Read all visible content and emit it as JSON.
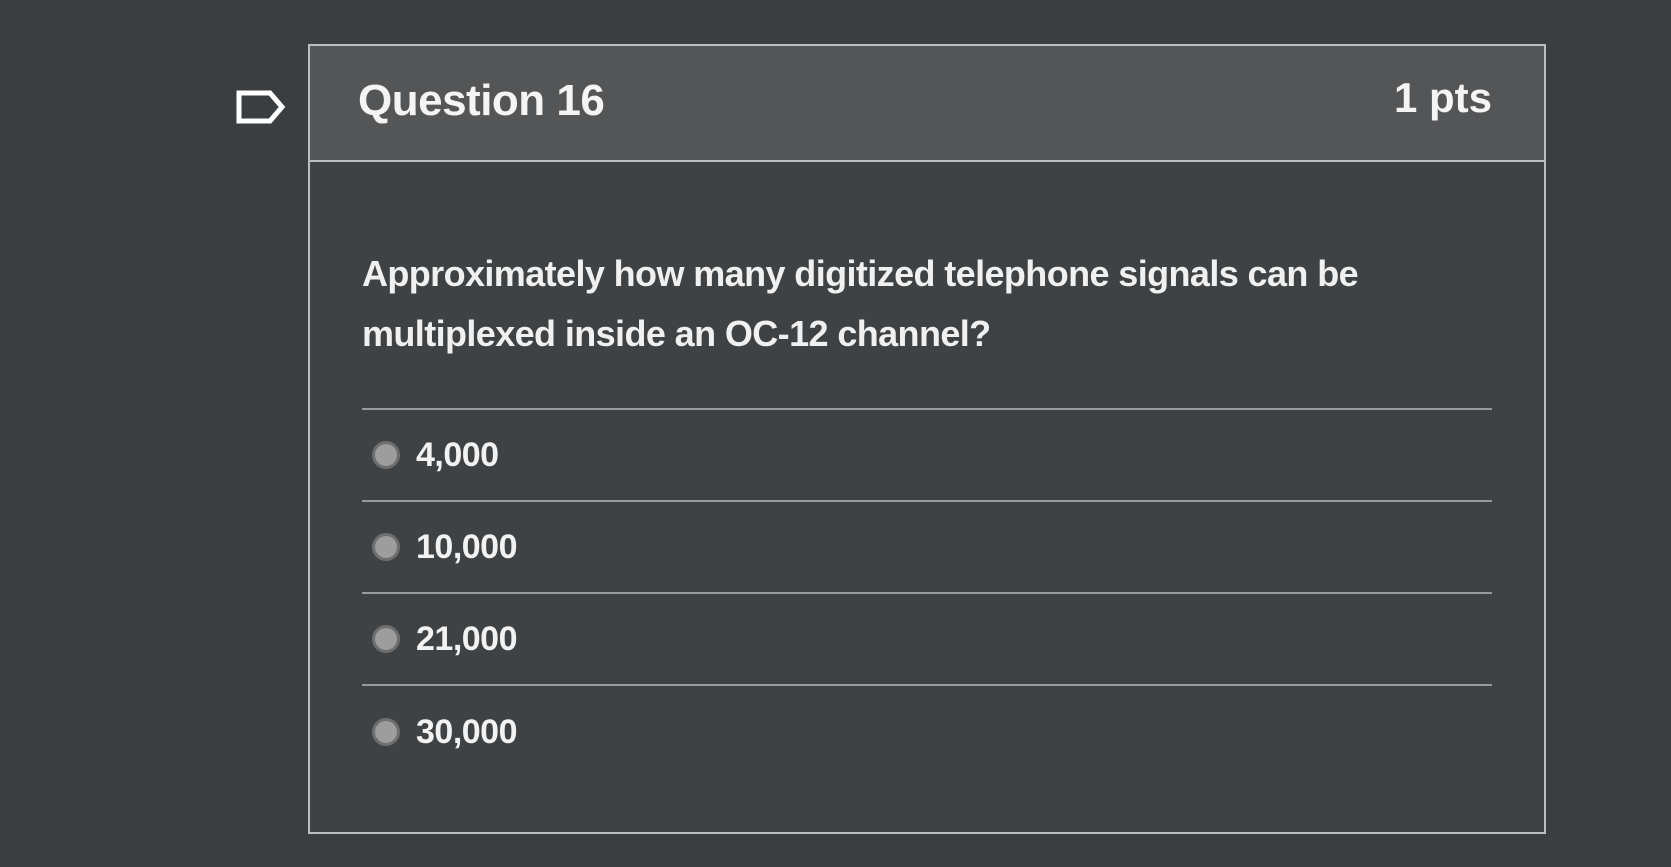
{
  "question": {
    "title": "Question 16",
    "points": "1 pts",
    "text": "Approximately how many digitized telephone signals can be multiplexed inside an OC-12 channel?",
    "flag_icon": "flag-icon"
  },
  "answers": [
    {
      "label": "4,000"
    },
    {
      "label": "10,000"
    },
    {
      "label": "21,000"
    },
    {
      "label": "30,000"
    }
  ],
  "colors": {
    "background": "#3b3e40",
    "header": "#535557",
    "border": "#bdbdbd",
    "radio": "#9d9d9d"
  }
}
